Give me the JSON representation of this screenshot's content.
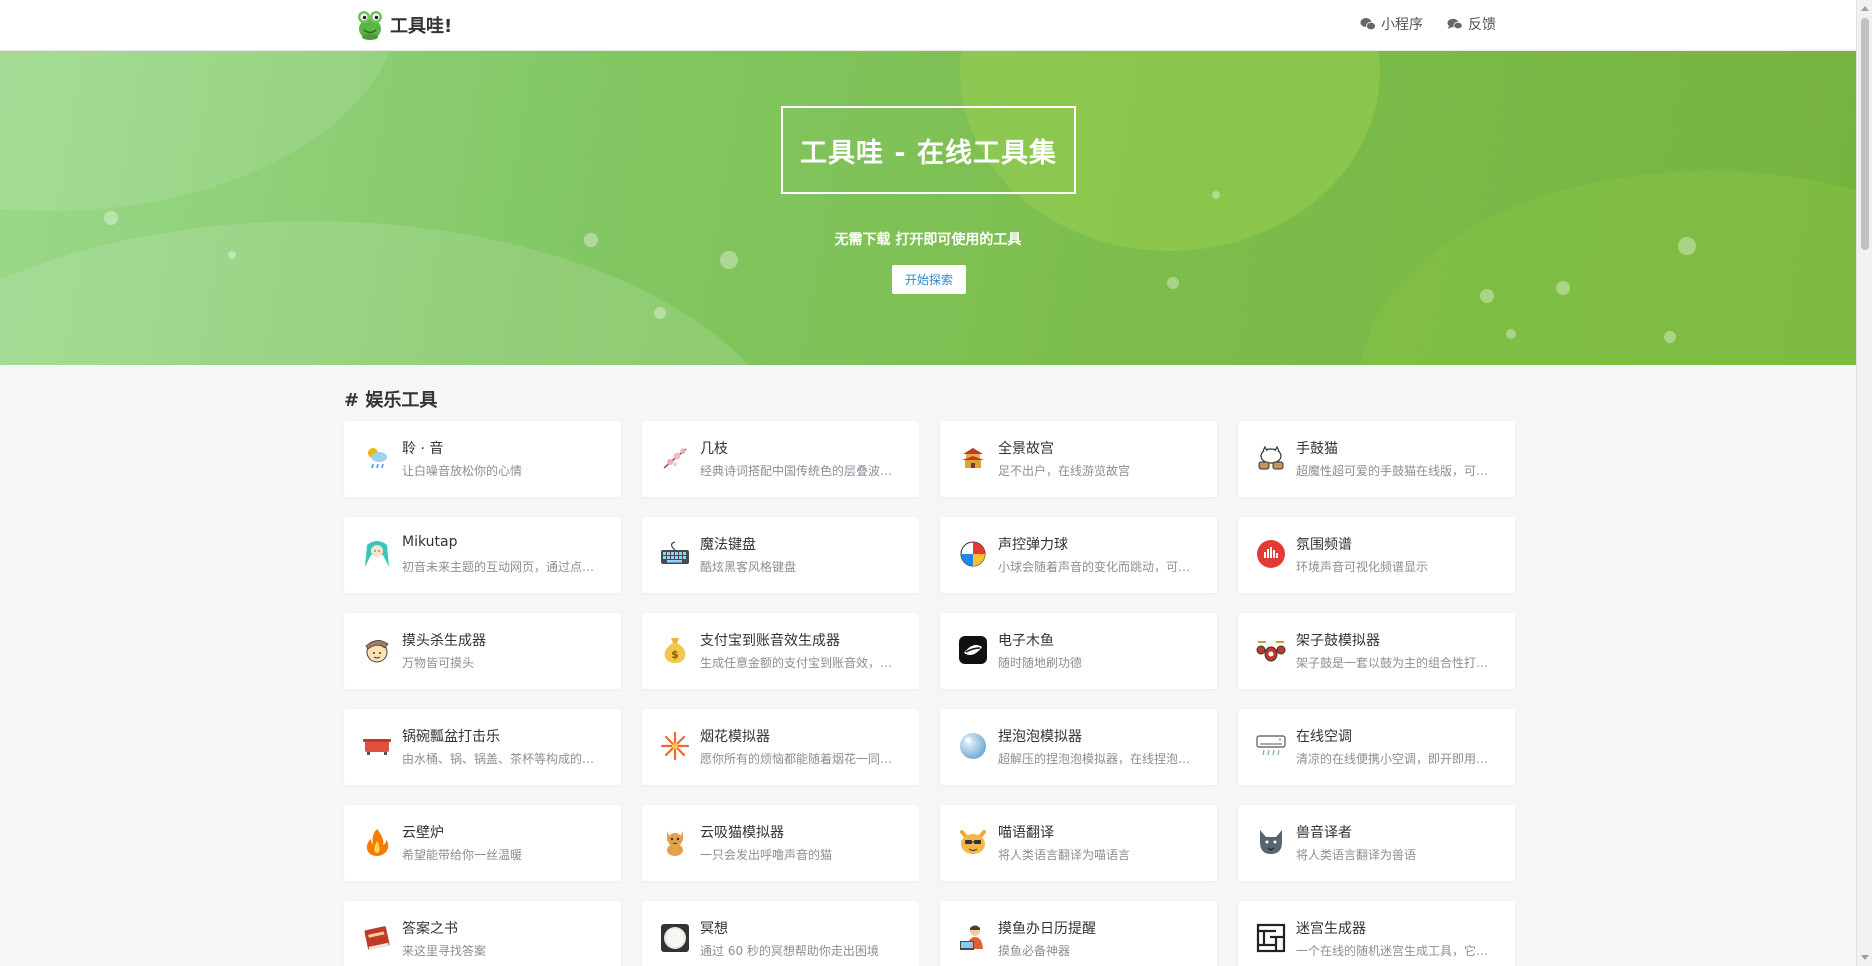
{
  "header": {
    "brand": "工具哇!",
    "links": [
      {
        "label": "小程序",
        "icon": "wechat-icon"
      },
      {
        "label": "反馈",
        "icon": "comments-icon"
      }
    ]
  },
  "hero": {
    "title": "工具哇 - 在线工具集",
    "subtitle": "无需下载 打开即可使用的工具",
    "button": "开始探索"
  },
  "section": {
    "title": "# 娱乐工具"
  },
  "cards": [
    {
      "title": "聆 · 音",
      "desc": "让白噪音放松你的心情",
      "icon": "weather-rain-icon"
    },
    {
      "title": "几枝",
      "desc": "经典诗词搭配中国传统色的层叠波…",
      "icon": "plum-blossom-icon"
    },
    {
      "title": "全景故宫",
      "desc": "足不出户，在线游览故宫",
      "icon": "palace-icon"
    },
    {
      "title": "手鼓猫",
      "desc": "超魔性超可爱的手鼓猫在线版，可…",
      "icon": "bongo-cat-icon"
    },
    {
      "title": "Mikutap",
      "desc": "初音未来主题的互动网页，通过点…",
      "icon": "miku-icon"
    },
    {
      "title": "魔法键盘",
      "desc": "酷炫黑客风格键盘",
      "icon": "keyboard-icon"
    },
    {
      "title": "声控弹力球",
      "desc": "小球会随着声音的变化而跳动，可…",
      "icon": "beach-ball-icon"
    },
    {
      "title": "氛围频谱",
      "desc": "环境声音可视化频谱显示",
      "icon": "spectrum-icon"
    },
    {
      "title": "摸头杀生成器",
      "desc": "万物皆可摸头",
      "icon": "pat-head-icon"
    },
    {
      "title": "支付宝到账音效生成器",
      "desc": "生成任意金额的支付宝到账音效，…",
      "icon": "money-bag-icon"
    },
    {
      "title": "电子木鱼",
      "desc": "随时随地刷功德",
      "icon": "wooden-fish-icon"
    },
    {
      "title": "架子鼓模拟器",
      "desc": "架子鼓是一套以鼓为主的组合性打…",
      "icon": "drum-kit-icon"
    },
    {
      "title": "锅碗瓢盆打击乐",
      "desc": "由水桶、锅、锅盖、茶杯等构成的…",
      "icon": "pot-icon"
    },
    {
      "title": "烟花模拟器",
      "desc": "愿你所有的烦恼都能随着烟花一同…",
      "icon": "firework-icon"
    },
    {
      "title": "捏泡泡模拟器",
      "desc": "超解压的捏泡泡模拟器，在线捏泡…",
      "icon": "bubble-icon"
    },
    {
      "title": "在线空调",
      "desc": "清凉的在线便携小空调，即开即用…",
      "icon": "air-conditioner-icon"
    },
    {
      "title": "云壁炉",
      "desc": "希望能带给你一丝温暖",
      "icon": "fire-icon"
    },
    {
      "title": "云吸猫模拟器",
      "desc": "一只会发出呼噜声音的猫",
      "icon": "cat-icon"
    },
    {
      "title": "喵语翻译",
      "desc": "将人类语言翻译为喵语言",
      "icon": "cat-face-icon"
    },
    {
      "title": "兽音译者",
      "desc": "将人类语言翻译为兽语",
      "icon": "wolf-icon"
    },
    {
      "title": "答案之书",
      "desc": "来这里寻找答案",
      "icon": "book-icon"
    },
    {
      "title": "冥想",
      "desc": "通过 60 秒的冥想帮助你走出困境",
      "icon": "meditation-icon"
    },
    {
      "title": "摸鱼办日历提醒",
      "desc": "摸鱼必备神器",
      "icon": "office-worker-icon"
    },
    {
      "title": "迷宫生成器",
      "desc": "一个在线的随机迷宫生成工具，它…",
      "icon": "maze-icon"
    }
  ]
}
